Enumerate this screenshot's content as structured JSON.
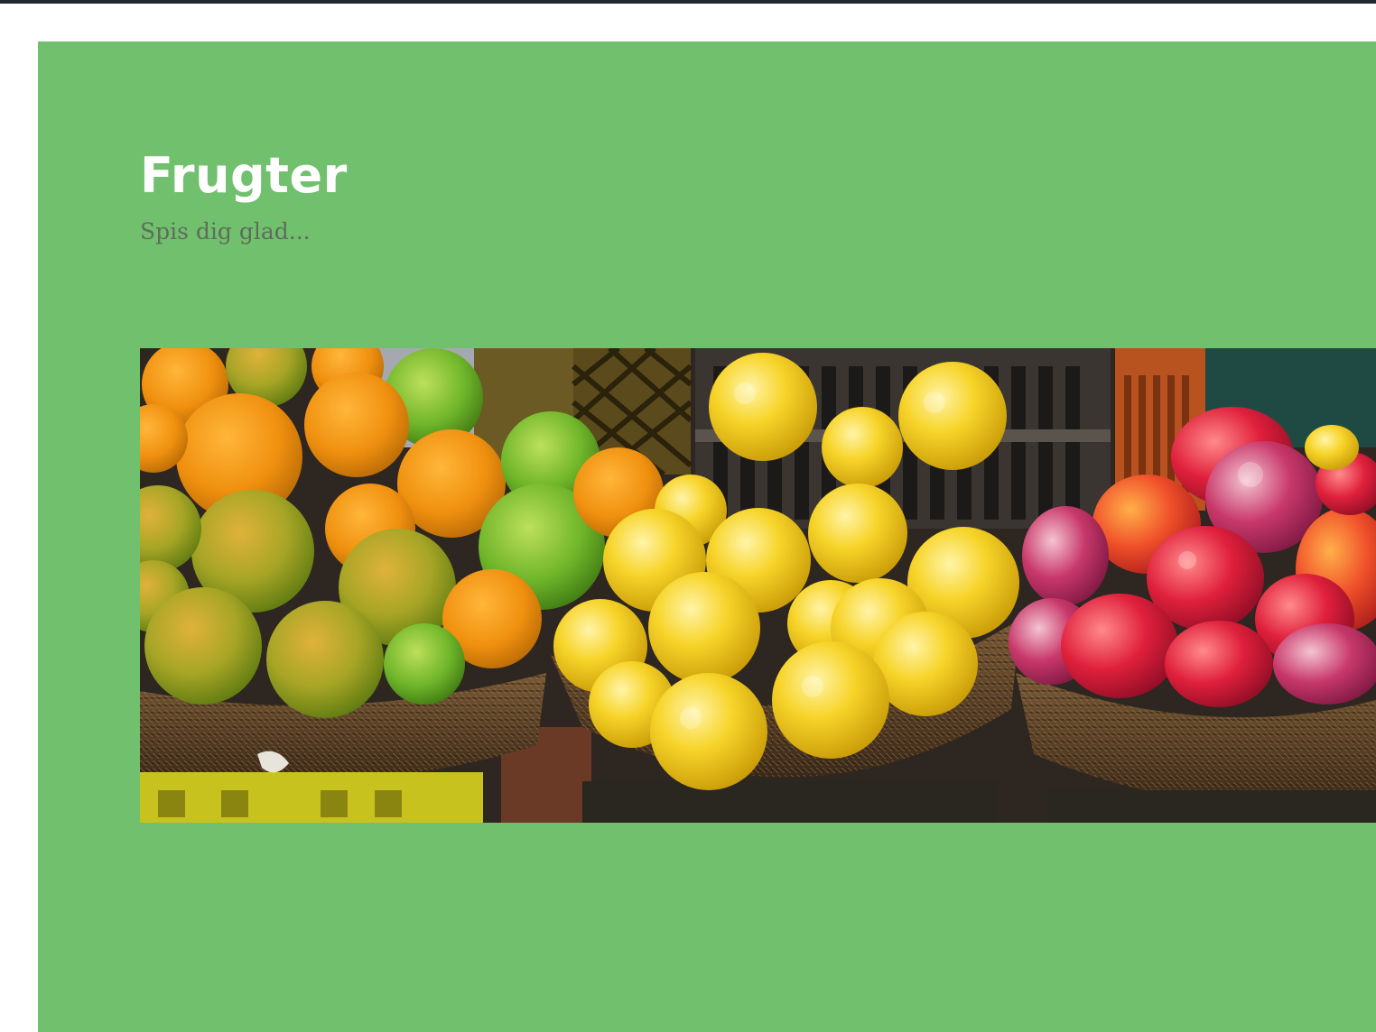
{
  "site": {
    "title": "Frugter",
    "tagline": "Spis dig glad..."
  },
  "header_image": {
    "subject": "fruit-baskets-photo"
  },
  "colors": {
    "panel_bg": "#71c06e",
    "title": "#ffffff",
    "tagline": "#5d6e5b",
    "topbar": "#23282d"
  }
}
